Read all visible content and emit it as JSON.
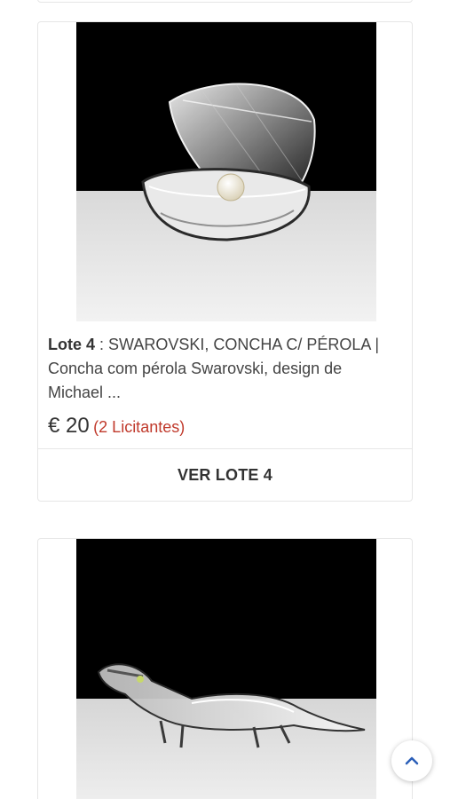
{
  "lots": [
    {
      "lot_label": "Lote 4",
      "separator": " : ",
      "description": "SWAROVSKI, CONCHA C/ PÉROLA | Concha com pérola Swarovski, design de Michael ...",
      "price": "€ 20",
      "bidders": "(2 Licitantes)",
      "button_label": "VER LOTE 4"
    }
  ],
  "colors": {
    "accent_link": "#c0392b",
    "scroll_arrow": "#2b5fb8",
    "photo_background": "#000000"
  },
  "icons": {
    "scroll_top": "chevron-up-icon"
  }
}
